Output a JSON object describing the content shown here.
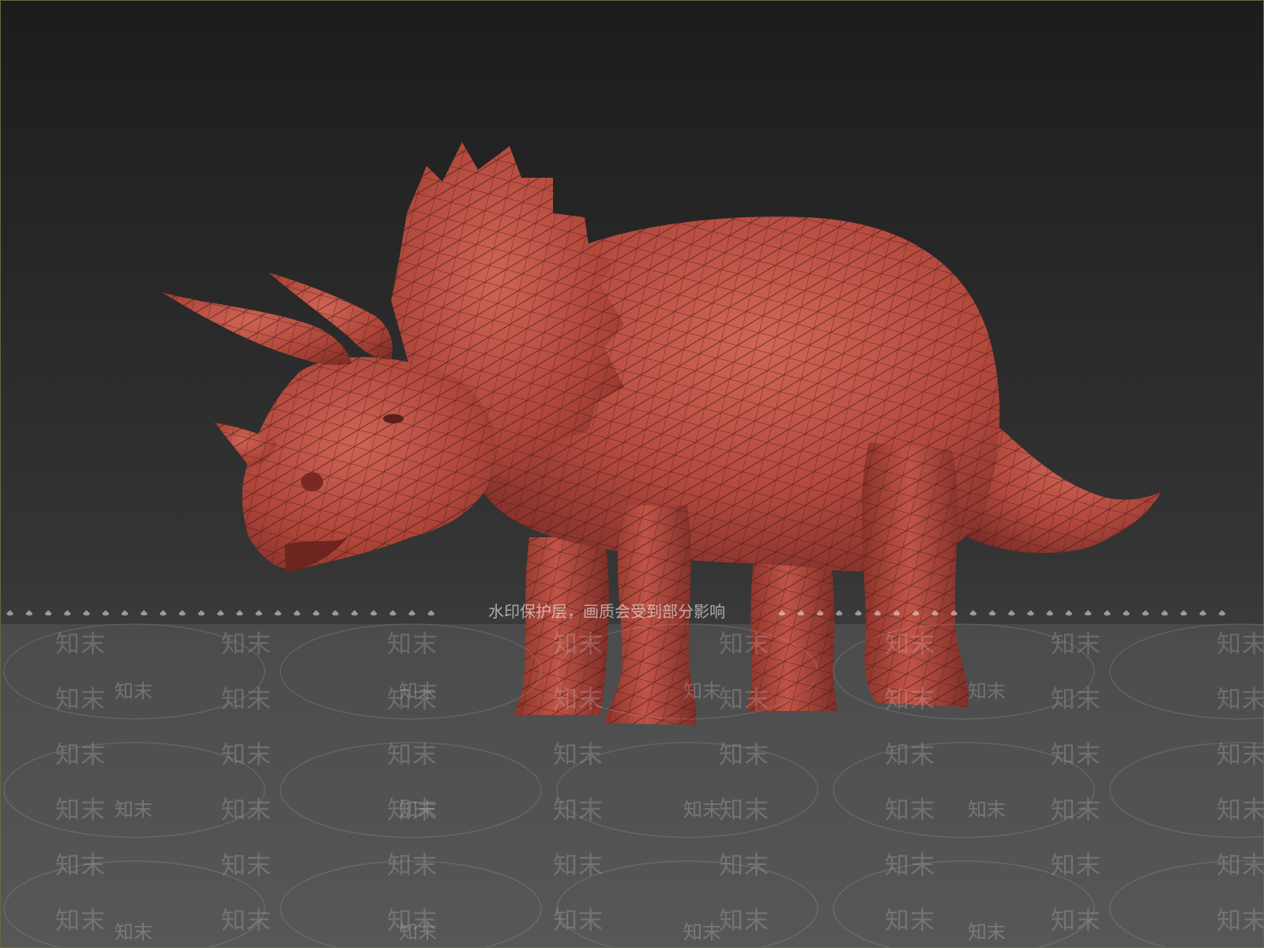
{
  "scene": {
    "subject": "triceratops-wireframe-model",
    "colors": {
      "skin": "#b84a3f",
      "skin_shadow": "#7e2e28",
      "skin_highlight": "#d56a5c",
      "wire": "#3d1512",
      "background_top": "#1c1c1c",
      "background_bottom": "#4a4a4a"
    }
  },
  "watermark": {
    "notice": "水印保护层，画质会受到部分影响",
    "word": "知末",
    "dots_left": "◆◆◆◆◆◆◆◆◆◆◆◆◆◆◆◆◆◆◆◆◆◆◆",
    "dots_right": "◆◆◆◆◆◆◆◆◆◆◆◆◆◆◆◆◆◆◆◆◆◆◆◆"
  }
}
